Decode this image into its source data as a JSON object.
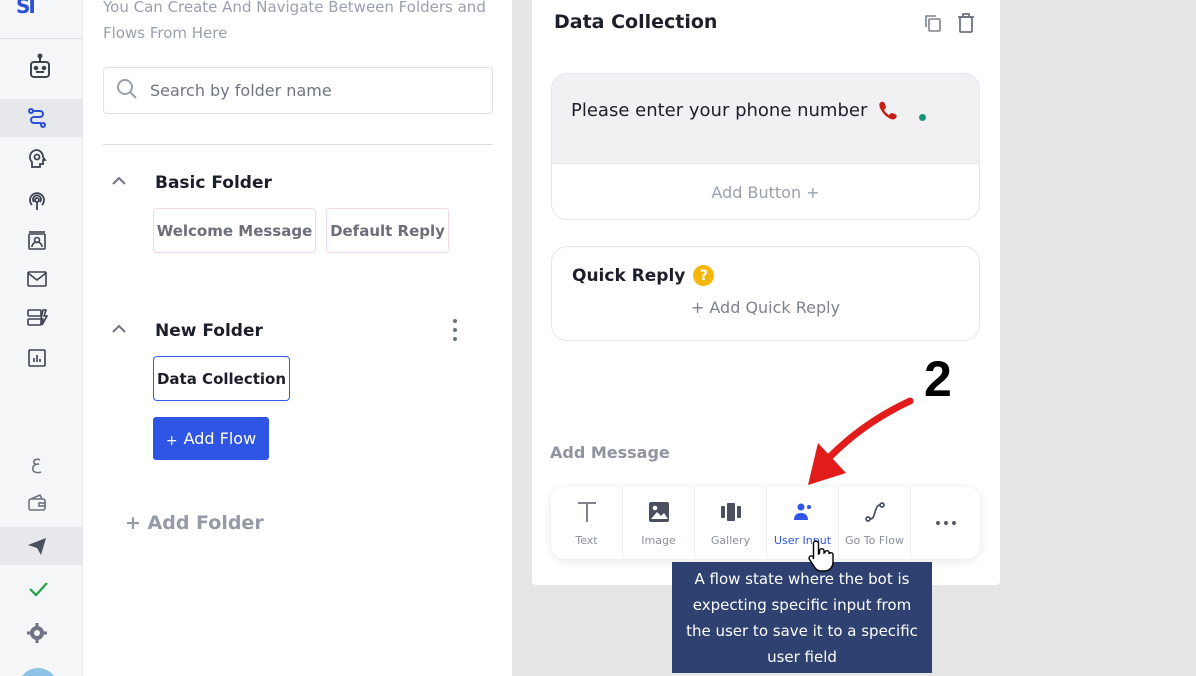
{
  "sidebar": {
    "logo_text": "SI",
    "items": [
      {
        "icon": "robot-icon"
      },
      {
        "icon": "flow-icon",
        "active": true
      },
      {
        "icon": "brain-icon"
      },
      {
        "icon": "broadcast-icon"
      },
      {
        "icon": "contacts-icon"
      },
      {
        "icon": "mail-icon"
      },
      {
        "icon": "templates-icon"
      },
      {
        "icon": "analytics-icon"
      },
      {
        "icon": "language-icon"
      },
      {
        "icon": "wallet-icon"
      },
      {
        "icon": "send-icon"
      },
      {
        "icon": "check-icon"
      },
      {
        "icon": "settings-icon"
      }
    ],
    "accent_color": "#2b4fd6"
  },
  "folders_panel": {
    "description": "You Can Create And Navigate Between Folders and Flows From Here",
    "search_placeholder": "Search by folder name",
    "folders": [
      {
        "name": "Basic Folder",
        "flows": [
          "Welcome Message",
          "Default Reply"
        ]
      },
      {
        "name": "New Folder",
        "flows": [
          "Data Collection"
        ]
      }
    ],
    "add_flow_label": "Add Flow",
    "add_flow_plus": "+",
    "add_folder_label": "+ Add Folder"
  },
  "flow_editor": {
    "title": "Data Collection",
    "message_text": "Please enter your phone number",
    "add_button_label": "Add Button +",
    "quick_reply_title": "Quick Reply",
    "quick_reply_help": "?",
    "add_quick_reply_label": "+ Add Quick Reply",
    "add_message_label": "Add Message",
    "toolbar": [
      {
        "label": "Text",
        "icon": "text-icon"
      },
      {
        "label": "Image",
        "icon": "image-icon"
      },
      {
        "label": "Gallery",
        "icon": "gallery-icon"
      },
      {
        "label": "User Input",
        "icon": "user-input-icon",
        "highlighted": true
      },
      {
        "label": "Go To Flow",
        "icon": "go-to-flow-icon"
      },
      {
        "label": "",
        "icon": "more-icon"
      }
    ],
    "tooltip": "A flow state where the bot is expecting specific input from the user to save it to a specific user field"
  },
  "annotation": {
    "step_number": "2",
    "arrow_color": "#e21b1b"
  },
  "colors": {
    "primary": "#2f55e4",
    "tooltip_bg": "#2e4171",
    "status_green": "#17977a"
  }
}
